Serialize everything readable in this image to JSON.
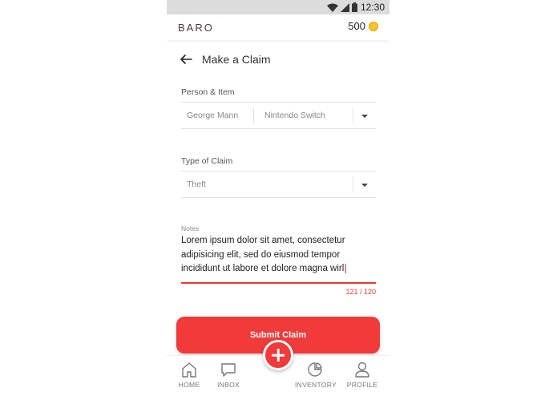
{
  "status_bar": {
    "time": "12:30"
  },
  "app_bar": {
    "brand": "BARO",
    "coin_balance": "500"
  },
  "page": {
    "title": "Make a Claim"
  },
  "person_item": {
    "label": "Person & Item",
    "person_value": "George Mann",
    "item_value": "Nintendo Switch"
  },
  "claim_type": {
    "label": "Type of Claim",
    "value": "Theft"
  },
  "notes": {
    "label": "Notes",
    "value": "Lorem ipsum dolor sit amet, consectetur adipisicing elit, sed do eiusmod tempor incididunt ut labore et dolore magna wirl",
    "counter": "121 / 120"
  },
  "submit_label": "Submit Claim",
  "nav": {
    "items": [
      {
        "label": "HOME",
        "icon": "home-icon"
      },
      {
        "label": "INBOX",
        "icon": "inbox-icon"
      },
      {
        "label": "INVENTORY",
        "icon": "inventory-icon"
      },
      {
        "label": "PROFILE",
        "icon": "profile-icon"
      }
    ],
    "fab_icon": "plus-icon"
  },
  "colors": {
    "accent": "#f13a3a",
    "error": "#e53935",
    "coin": "#f4c430"
  }
}
